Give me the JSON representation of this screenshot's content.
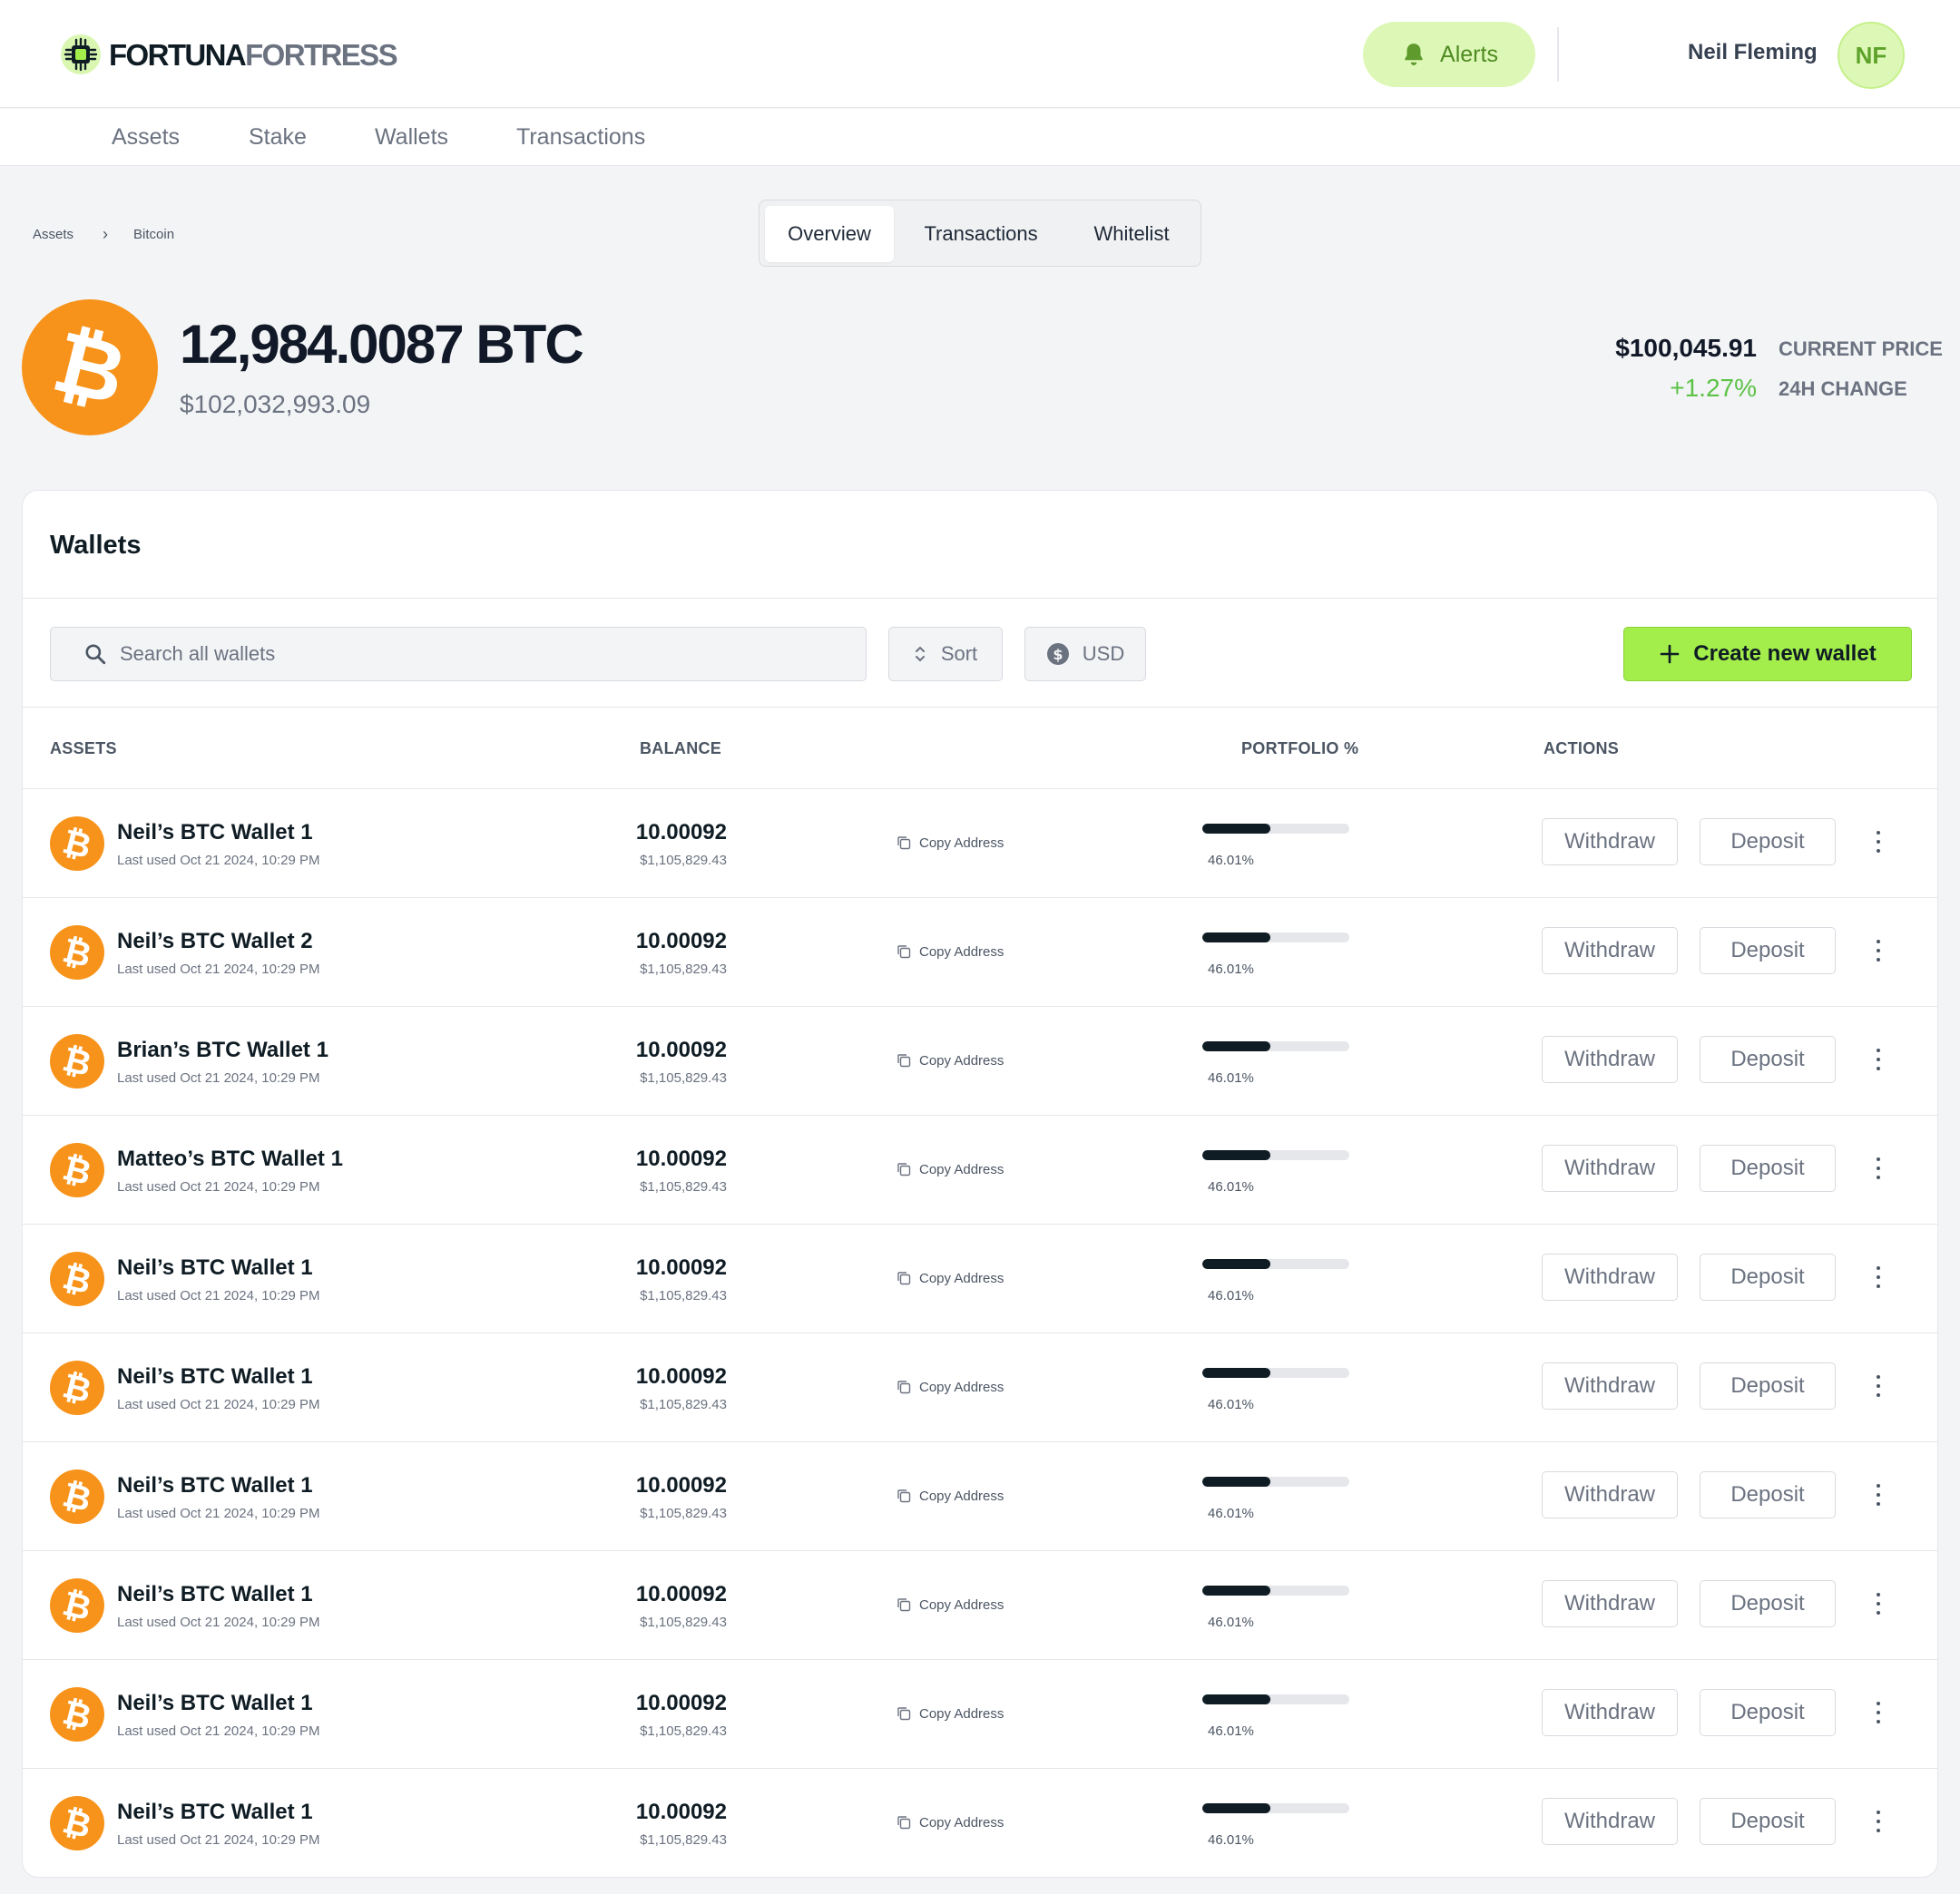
{
  "brand": {
    "part1": "FORTUNA",
    "part2": "FORTRESS",
    "accent_color": "#a3ee4b"
  },
  "header": {
    "alerts_label": "Alerts",
    "user_name": "Neil Fleming",
    "user_initials": "NF"
  },
  "nav": {
    "items": [
      "Assets",
      "Stake",
      "Wallets",
      "Transactions"
    ]
  },
  "breadcrumb": {
    "items": [
      "Assets",
      "Bitcoin"
    ]
  },
  "tabs": {
    "items": [
      "Overview",
      "Transactions",
      "Whitelist"
    ],
    "active": "Overview"
  },
  "asset": {
    "amount": "12,984.0087 BTC",
    "usd_value": "$102,032,993.09",
    "current_price": "$100,045.91",
    "current_price_label": "CURRENT PRICE",
    "change_24h": "+1.27%",
    "change_24h_label": "24H CHANGE",
    "change_color": "#5cc347",
    "coin_color": "#f7931a"
  },
  "wallets": {
    "title": "Wallets",
    "search_placeholder": "Search all wallets",
    "sort_label": "Sort",
    "currency_label": "USD",
    "create_label": "Create new wallet",
    "columns": {
      "assets": "ASSETS",
      "balance": "BALANCE",
      "portfolio": "PORTFOLIO %",
      "actions": "ACTIONS"
    },
    "copy_label": "Copy Address",
    "withdraw_label": "Withdraw",
    "deposit_label": "Deposit",
    "rows": [
      {
        "name": "Neil’s BTC Wallet 1",
        "last_used": "Last used Oct 21 2024, 10:29 PM",
        "balance": "10.00092",
        "usd": "$1,105,829.43",
        "portfolio": "46.01%",
        "portfolio_value": 0.4601
      },
      {
        "name": "Neil’s BTC Wallet 2",
        "last_used": "Last used Oct 21 2024, 10:29 PM",
        "balance": "10.00092",
        "usd": "$1,105,829.43",
        "portfolio": "46.01%",
        "portfolio_value": 0.4601
      },
      {
        "name": "Brian’s BTC Wallet 1",
        "last_used": "Last used Oct 21 2024, 10:29 PM",
        "balance": "10.00092",
        "usd": "$1,105,829.43",
        "portfolio": "46.01%",
        "portfolio_value": 0.4601
      },
      {
        "name": "Matteo’s BTC Wallet 1",
        "last_used": "Last used Oct 21 2024, 10:29 PM",
        "balance": "10.00092",
        "usd": "$1,105,829.43",
        "portfolio": "46.01%",
        "portfolio_value": 0.4601
      },
      {
        "name": "Neil’s BTC Wallet 1",
        "last_used": "Last used Oct 21 2024, 10:29 PM",
        "balance": "10.00092",
        "usd": "$1,105,829.43",
        "portfolio": "46.01%",
        "portfolio_value": 0.4601
      },
      {
        "name": "Neil’s BTC Wallet 1",
        "last_used": "Last used Oct 21 2024, 10:29 PM",
        "balance": "10.00092",
        "usd": "$1,105,829.43",
        "portfolio": "46.01%",
        "portfolio_value": 0.4601
      },
      {
        "name": "Neil’s BTC Wallet 1",
        "last_used": "Last used Oct 21 2024, 10:29 PM",
        "balance": "10.00092",
        "usd": "$1,105,829.43",
        "portfolio": "46.01%",
        "portfolio_value": 0.4601
      },
      {
        "name": "Neil’s BTC Wallet 1",
        "last_used": "Last used Oct 21 2024, 10:29 PM",
        "balance": "10.00092",
        "usd": "$1,105,829.43",
        "portfolio": "46.01%",
        "portfolio_value": 0.4601
      },
      {
        "name": "Neil’s BTC Wallet 1",
        "last_used": "Last used Oct 21 2024, 10:29 PM",
        "balance": "10.00092",
        "usd": "$1,105,829.43",
        "portfolio": "46.01%",
        "portfolio_value": 0.4601
      },
      {
        "name": "Neil’s BTC Wallet 1",
        "last_used": "Last used Oct 21 2024, 10:29 PM",
        "balance": "10.00092",
        "usd": "$1,105,829.43",
        "portfolio": "46.01%",
        "portfolio_value": 0.4601
      }
    ]
  },
  "icons": [
    "chip-logo-icon",
    "bell-icon",
    "bitcoin-icon",
    "search-icon",
    "sort-icon",
    "dollar-icon",
    "plus-icon",
    "copy-icon",
    "more-vertical-icon",
    "chevron-right-icon"
  ]
}
